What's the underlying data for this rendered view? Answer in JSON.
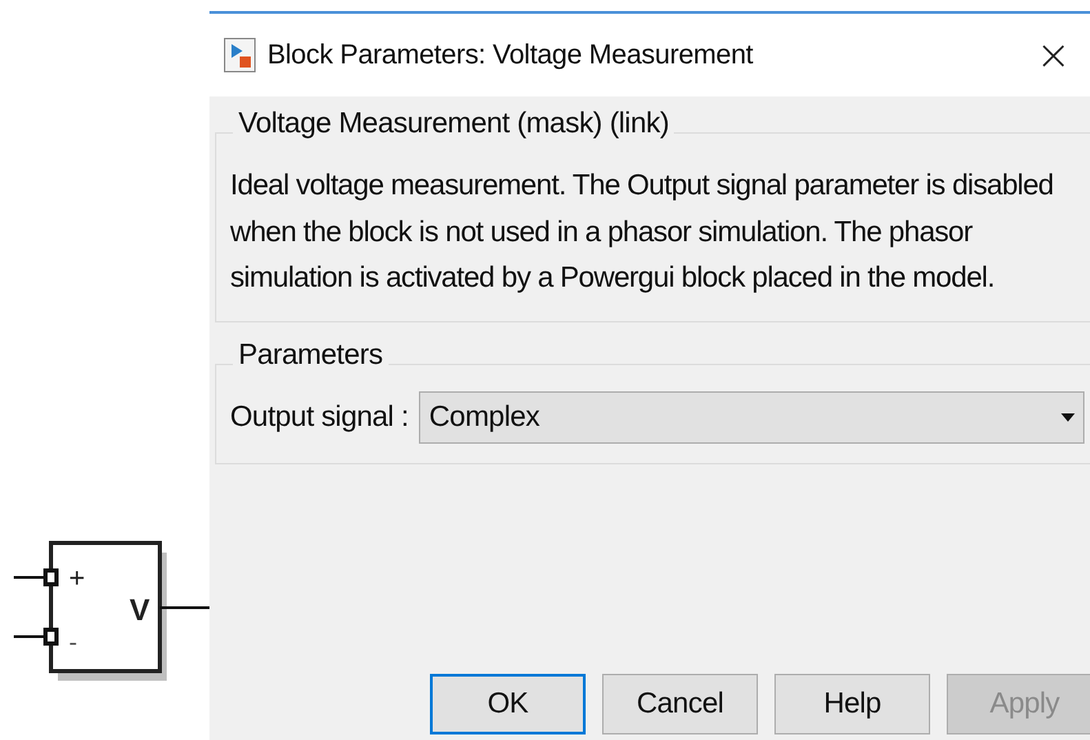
{
  "canvas": {
    "block": {
      "plus_label": "+",
      "minus_label": "-",
      "output_label": "V"
    }
  },
  "window": {
    "title": "Block Parameters: Voltage Measurement",
    "close": "×"
  },
  "description_group": {
    "title": "Voltage Measurement (mask) (link)",
    "text": "Ideal voltage measurement. The Output signal parameter is disabled when the block is not used in a phasor simulation. The phasor simulation is activated by a Powergui block placed in the model."
  },
  "parameters_group": {
    "title": "Parameters",
    "fields": [
      {
        "label": "Output signal :",
        "value": "Complex"
      }
    ]
  },
  "buttons": [
    {
      "label": "OK",
      "kind": "default",
      "disabled": false
    },
    {
      "label": "Cancel",
      "kind": "normal",
      "disabled": false
    },
    {
      "label": "Help",
      "kind": "normal",
      "disabled": false
    },
    {
      "label": "Apply",
      "kind": "normal",
      "disabled": true
    }
  ]
}
